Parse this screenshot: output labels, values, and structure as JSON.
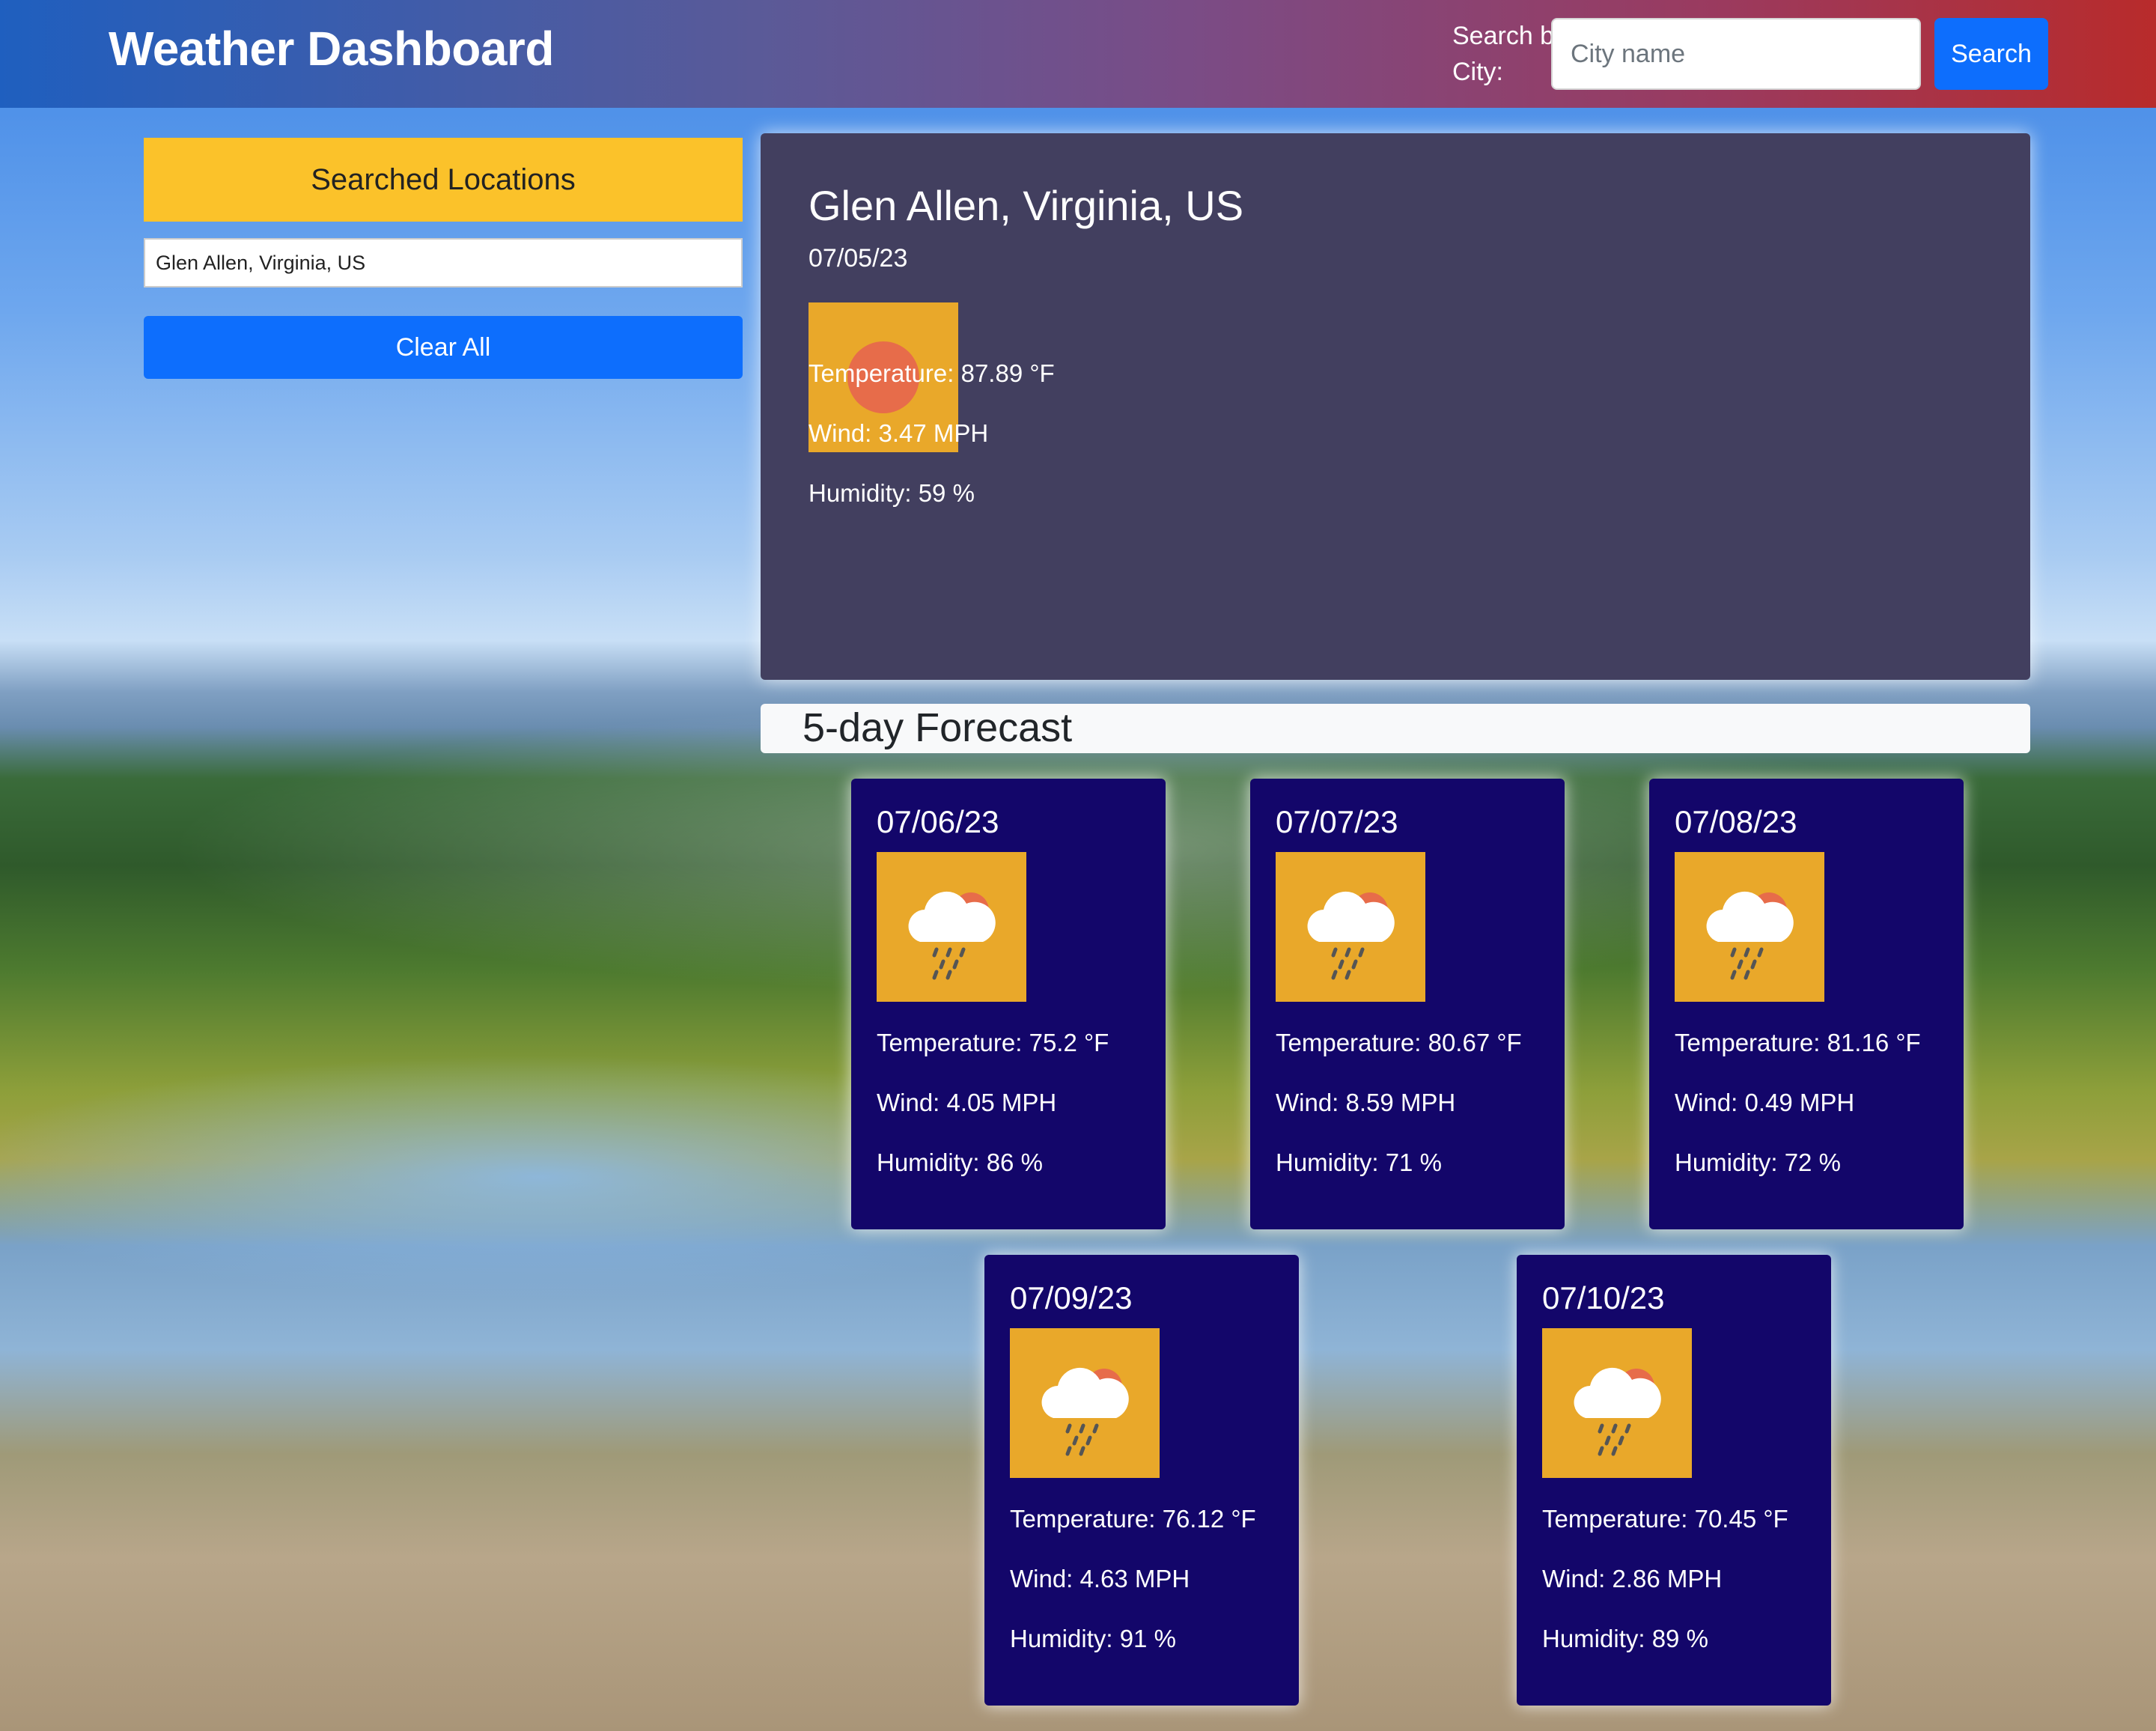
{
  "header": {
    "title": "Weather Dashboard",
    "search_label": "Search by City:",
    "search_placeholder": "City name",
    "search_value": "",
    "search_button": "Search"
  },
  "sidebar": {
    "header": "Searched Locations",
    "locations": [
      "Glen Allen, Virginia, US"
    ],
    "clear_button": "Clear All"
  },
  "current": {
    "city": "Glen Allen, Virginia, US",
    "date": "07/05/23",
    "icon": "sun-icon",
    "temperature": "Temperature: 87.89 °F",
    "wind": "Wind: 3.47 MPH",
    "humidity": "Humidity: 59 %"
  },
  "forecast": {
    "title": "5-day Forecast",
    "days": [
      {
        "date": "07/06/23",
        "icon": "rain-cloud-sun-icon",
        "temperature": "Temperature: 75.2 °F",
        "wind": "Wind: 4.05 MPH",
        "humidity": "Humidity: 86 %"
      },
      {
        "date": "07/07/23",
        "icon": "rain-cloud-sun-icon",
        "temperature": "Temperature: 80.67 °F",
        "wind": "Wind: 8.59 MPH",
        "humidity": "Humidity: 71 %"
      },
      {
        "date": "07/08/23",
        "icon": "rain-cloud-sun-icon",
        "temperature": "Temperature: 81.16 °F",
        "wind": "Wind: 0.49 MPH",
        "humidity": "Humidity: 72 %"
      },
      {
        "date": "07/09/23",
        "icon": "rain-cloud-sun-icon",
        "temperature": "Temperature: 76.12 °F",
        "wind": "Wind: 4.63 MPH",
        "humidity": "Humidity: 91 %"
      },
      {
        "date": "07/10/23",
        "icon": "rain-cloud-sun-icon",
        "temperature": "Temperature: 70.45 °F",
        "wind": "Wind: 2.86 MPH",
        "humidity": "Humidity: 89 %"
      }
    ]
  },
  "colors": {
    "header_gradient_start": "#1f5fbf",
    "header_gradient_end": "#b82b2b",
    "primary_button": "#0d6efd",
    "sidebar_header": "#fbc22a",
    "current_card": "#423f5f",
    "forecast_card": "#13066a",
    "icon_background": "#e9a82a"
  }
}
